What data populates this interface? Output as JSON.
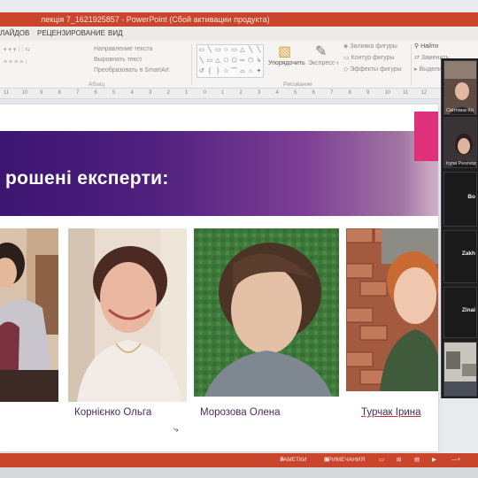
{
  "window": {
    "title": "лекція 7_1621925857  -  PowerPoint (Сбой активации продукта)"
  },
  "ribbon": {
    "tabs": [
      "ЛАЙДОВ",
      "РЕЦЕНЗИРОВАНИЕ",
      "ВИД"
    ],
    "paragraph_items": [
      "Направление текста",
      "Выровнять текст",
      "Преобразовать в SmartArt"
    ],
    "paragraph_group": "Абзац",
    "drawing_group": "Рисование",
    "arrange_label": "Упорядочить",
    "quick_styles_label": "Экспресс-стили",
    "shape_format_items": [
      "Заливка фигуры",
      "Контур фигуры",
      "Эффекты фигуры"
    ],
    "editing_items": [
      "Найти",
      "Заменить",
      "Выделить"
    ],
    "shape_glyphs": [
      "▭",
      "╲",
      "▭",
      "○",
      "▭",
      "△",
      "╲",
      "╲",
      "╲",
      "▭",
      "△",
      "□",
      "⬠",
      "⇨",
      "⬡",
      "↳",
      "↺",
      "{",
      "}",
      "☆",
      "⌒",
      "⌓",
      "⌂",
      "✦"
    ]
  },
  "ruler": {
    "ticks": [
      "11",
      "10",
      "9",
      "8",
      "7",
      "6",
      "5",
      "4",
      "3",
      "2",
      "1",
      "0",
      "1",
      "2",
      "3",
      "4",
      "5",
      "6",
      "7",
      "8",
      "9",
      "10",
      "11",
      "12"
    ]
  },
  "slide": {
    "title": "рошені експерти:",
    "experts": [
      {
        "name": ""
      },
      {
        "name": "Корнієнко Ольга"
      },
      {
        "name": "Морозова Олена"
      },
      {
        "name": "Турчак Ірина"
      }
    ]
  },
  "zoom_panel": {
    "participants": [
      {
        "name": "Світлана Кл",
        "label": ""
      },
      {
        "name": "Iryna Perevoz",
        "label": ""
      },
      {
        "name": "",
        "label": "Bo"
      },
      {
        "name": "",
        "label": "Zakh"
      },
      {
        "name": "",
        "label": "Zinai"
      },
      {
        "name": "",
        "label": ""
      }
    ]
  },
  "statusbar": {
    "notes_label": "ЗАМЕТКИ",
    "comments_label": "ПРИМЕЧАНИЯ"
  },
  "colors": {
    "accent": "#c9452b",
    "banner_start": "#3b1670",
    "banner_end": "#b08aa8",
    "caption_text": "#4a2a5a"
  }
}
